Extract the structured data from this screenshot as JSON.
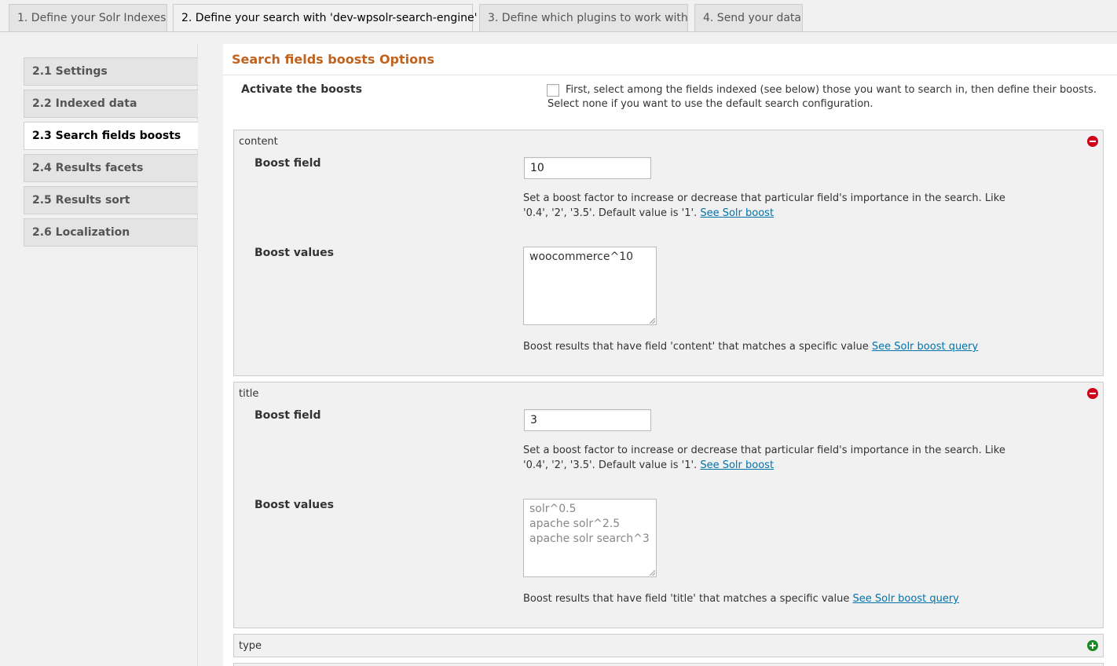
{
  "top_tabs": [
    {
      "label": "1. Define your Solr Indexes"
    },
    {
      "label": "2. Define your search with 'dev-wpsolr-search-engine'"
    },
    {
      "label": "3. Define which plugins to work with"
    },
    {
      "label": "4. Send your data"
    }
  ],
  "sidebar": {
    "items": [
      {
        "label": "2.1 Settings"
      },
      {
        "label": "2.2 Indexed data"
      },
      {
        "label": "2.3 Search fields boosts"
      },
      {
        "label": "2.4 Results facets"
      },
      {
        "label": "2.5 Results sort"
      },
      {
        "label": "2.6 Localization"
      }
    ]
  },
  "main": {
    "title": "Search fields boosts Options",
    "activate_label": "Activate the boosts",
    "activate_desc": "First, select among the fields indexed (see below) those you want to search in, then define their boosts. Select none if you want to use the default search configuration."
  },
  "fields": [
    {
      "name": "content",
      "boost_field_label": "Boost field",
      "boost_field_value": "10",
      "boost_field_desc": "Set a boost factor to increase or decrease that particular field's importance in the search. Like '0.4', '2', '3.5'. Default value is '1'.",
      "boost_field_link": "See Solr boost",
      "boost_values_label": "Boost values",
      "boost_values_value": "woocommerce^10",
      "boost_values_desc": "Boost results that have field 'content' that matches a specific value",
      "boost_values_link": "See Solr boost query"
    },
    {
      "name": "title",
      "boost_field_label": "Boost field",
      "boost_field_value": "3",
      "boost_field_desc": "Set a boost factor to increase or decrease that particular field's importance in the search. Like '0.4', '2', '3.5'. Default value is '1'.",
      "boost_field_link": "See Solr boost",
      "boost_values_label": "Boost values",
      "boost_values_value": "solr^0.5\napache solr^2.5\napache solr search^3",
      "boost_values_desc": "Boost results that have field 'title' that matches a specific value",
      "boost_values_link": "See Solr boost query"
    },
    {
      "name": "type"
    }
  ],
  "colors": {
    "title": "#c0631e",
    "link": "#0073aa",
    "remove_icon": "#d0021b",
    "add_icon": "#1a8a24"
  }
}
